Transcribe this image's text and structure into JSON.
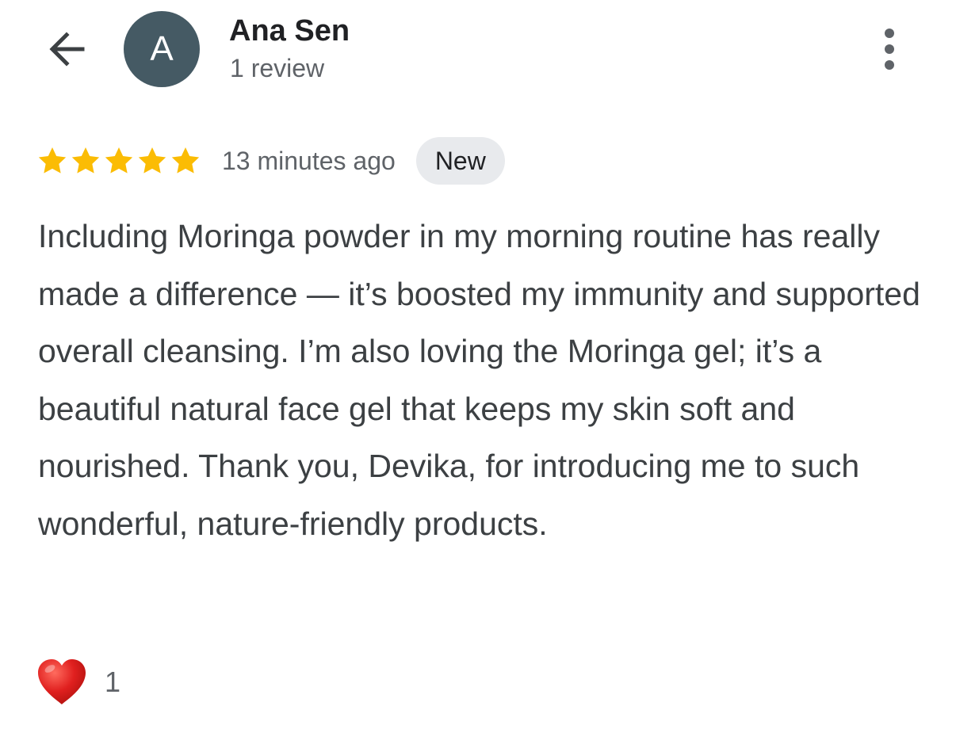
{
  "header": {
    "avatar_letter": "A",
    "user_name": "Ana Sen",
    "review_count": "1 review",
    "avatar_color": "#455a64",
    "back_icon": "arrow-left-icon",
    "more_icon": "more-vertical-icon"
  },
  "review": {
    "rating": 5,
    "max_rating": 5,
    "star_color": "#fbbc04",
    "time_ago": "13 minutes ago",
    "badge": "New",
    "text": "Including Moringa powder in my morning routine has really made a difference — it’s boosted my immunity and supported overall cleansing. I’m also loving the Moringa gel; it’s a beautiful natural face gel that keeps my skin soft and nourished. Thank you, Devika, for introducing me to such wonderful, nature-friendly products."
  },
  "reactions": {
    "icon": "heart-icon",
    "count": "1",
    "heart_color": "#e0201f"
  }
}
